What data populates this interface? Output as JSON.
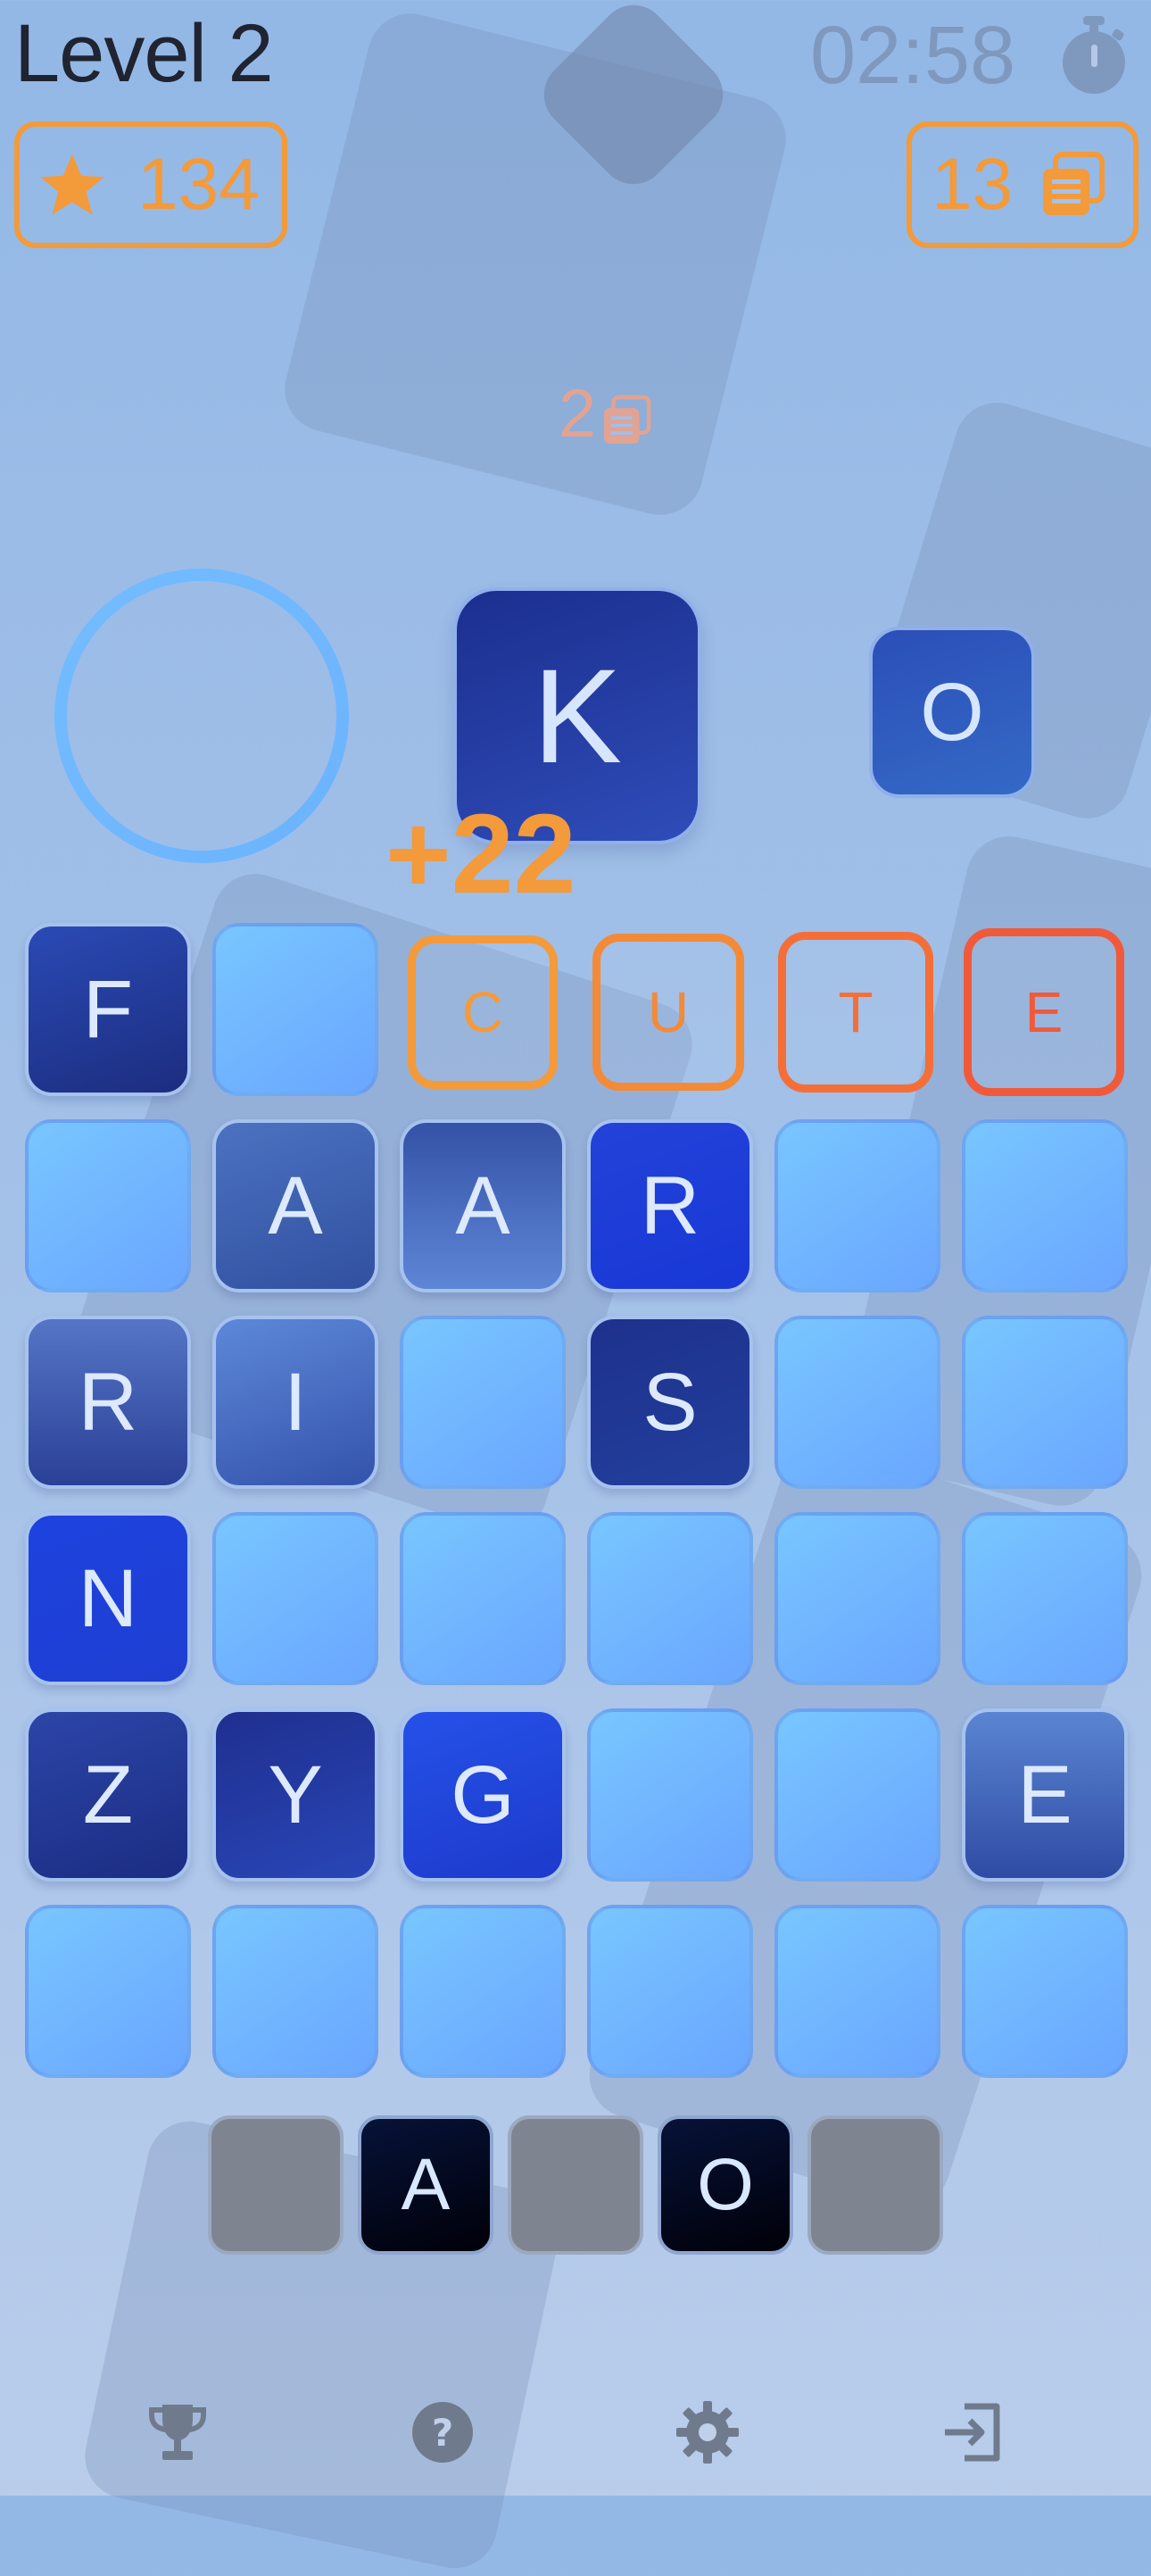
{
  "header": {
    "level": "Level 2",
    "timer": "02:58",
    "stopwatch_icon": "stopwatch-icon"
  },
  "stats": {
    "score": "134",
    "score_icon": "star-icon",
    "words": "13",
    "words_icon": "cards-icon"
  },
  "pending_words": "2",
  "current_letter": "K",
  "next_letter": "O",
  "score_popup": "+22",
  "board": {
    "row1": [
      "F",
      "",
      "C",
      "U",
      "T",
      "E"
    ],
    "row2": [
      "",
      "A",
      "A",
      "R",
      "",
      ""
    ],
    "row3": [
      "R",
      "I",
      "",
      "S",
      "",
      ""
    ],
    "row4": [
      "N",
      "",
      "",
      "",
      "",
      ""
    ],
    "row5": [
      "Z",
      "Y",
      "G",
      "",
      "",
      "E"
    ],
    "row6": [
      "",
      "",
      "",
      "",
      "",
      ""
    ]
  },
  "found_word": "CUTE",
  "rack": [
    "",
    "A",
    "",
    "O",
    ""
  ],
  "nav": {
    "items": [
      "trophy-icon",
      "help-icon",
      "settings-icon",
      "exit-icon"
    ]
  },
  "colors": {
    "accent_orange": "#f39a3b",
    "word_red": "#f05a3a",
    "tile_blue": "#6aa6ff",
    "tile_dark": "#1b2f8f"
  }
}
